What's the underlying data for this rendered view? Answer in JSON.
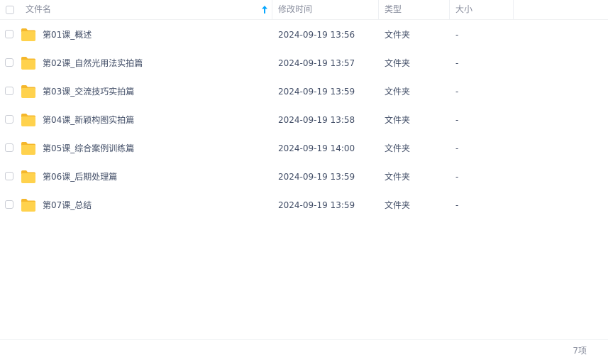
{
  "header": {
    "name_label": "文件名",
    "time_label": "修改时间",
    "type_label": "类型",
    "size_label": "大小",
    "sort_icon": "sort-ascending-arrow-icon"
  },
  "files": [
    {
      "name": "第01课_概述",
      "time": "2024-09-19 13:56",
      "type": "文件夹",
      "size": "-"
    },
    {
      "name": "第02课_自然光用法实拍篇",
      "time": "2024-09-19 13:57",
      "type": "文件夹",
      "size": "-"
    },
    {
      "name": "第03课_交流技巧实拍篇",
      "time": "2024-09-19 13:59",
      "type": "文件夹",
      "size": "-"
    },
    {
      "name": "第04课_新颖构图实拍篇",
      "time": "2024-09-19 13:58",
      "type": "文件夹",
      "size": "-"
    },
    {
      "name": "第05课_综合案例训练篇",
      "time": "2024-09-19 14:00",
      "type": "文件夹",
      "size": "-"
    },
    {
      "name": "第06课_后期处理篇",
      "time": "2024-09-19 13:59",
      "type": "文件夹",
      "size": "-"
    },
    {
      "name": "第07课_总结",
      "time": "2024-09-19 13:59",
      "type": "文件夹",
      "size": "-"
    }
  ],
  "footer": {
    "item_count": "7项"
  },
  "colors": {
    "accent": "#06a7ff",
    "folder_body": "#ffd24d",
    "folder_tab": "#f5b72b"
  }
}
